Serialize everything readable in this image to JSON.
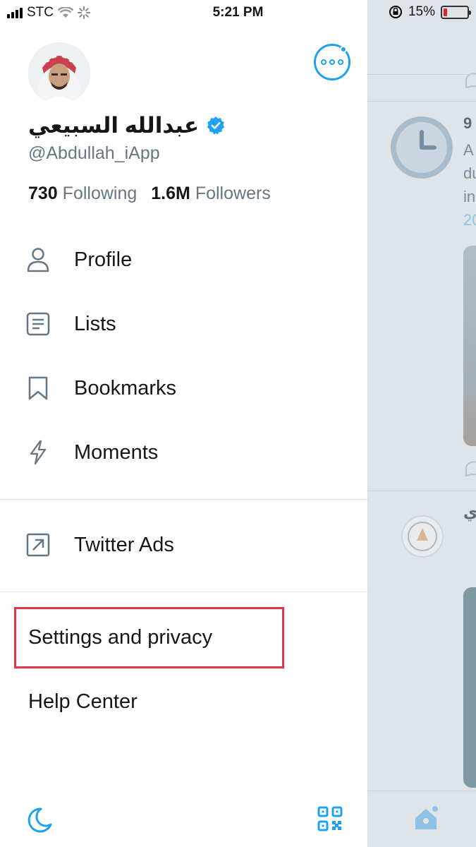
{
  "status_bar": {
    "carrier": "STC",
    "time": "5:21 PM",
    "battery_percent": "15%",
    "battery_level": 0.15,
    "battery_color": "#e5222b"
  },
  "profile": {
    "display_name": "عبدالله السبيعي",
    "handle": "@Abdullah_iApp",
    "following_count": "730",
    "following_label": "Following",
    "followers_count": "1.6M",
    "followers_label": "Followers"
  },
  "menu": {
    "items": [
      {
        "label": "Profile",
        "icon": "person-icon"
      },
      {
        "label": "Lists",
        "icon": "list-icon"
      },
      {
        "label": "Bookmarks",
        "icon": "bookmark-icon"
      },
      {
        "label": "Moments",
        "icon": "lightning-icon"
      }
    ],
    "ads": {
      "label": "Twitter Ads",
      "icon": "external-arrow-icon"
    },
    "settings_label": "Settings and privacy",
    "help_label": "Help Center"
  },
  "timeline": {
    "snippets": [
      "9",
      "A",
      "du",
      "in",
      "20",
      "ي"
    ]
  },
  "colors": {
    "accent": "#1da1f2",
    "highlight": "#e5354a",
    "text": "#14171a",
    "secondary": "#657786"
  }
}
